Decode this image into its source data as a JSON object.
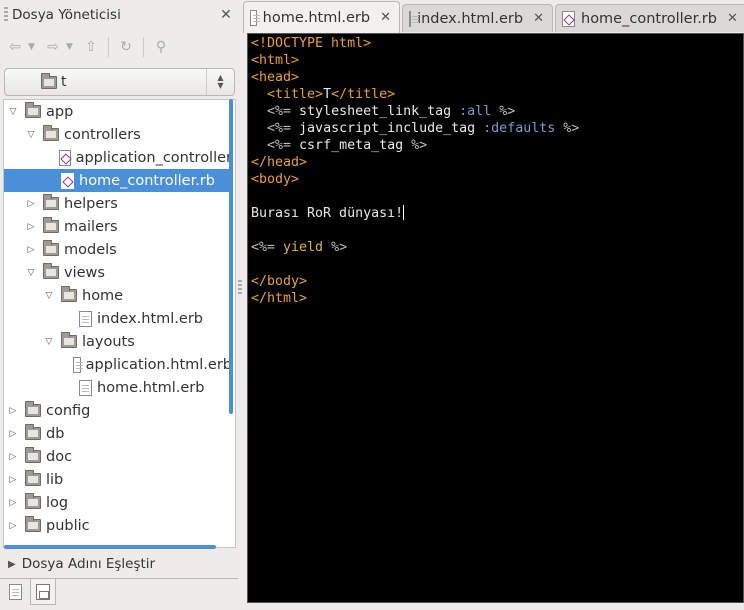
{
  "side_panel": {
    "title": "Dosya Yöneticisi",
    "close": "✕",
    "location": "t",
    "bottom_label": "Dosya Adını Eşleştir"
  },
  "tree": [
    {
      "label": "app",
      "kind": "folder",
      "expanded": true,
      "depth": 0
    },
    {
      "label": "controllers",
      "kind": "folder",
      "expanded": true,
      "depth": 1
    },
    {
      "label": "application_controller",
      "kind": "rb",
      "depth": 2
    },
    {
      "label": "home_controller.rb",
      "kind": "rb",
      "depth": 2,
      "selected": true
    },
    {
      "label": "helpers",
      "kind": "folder",
      "expanded": false,
      "depth": 1
    },
    {
      "label": "mailers",
      "kind": "folder",
      "expanded": false,
      "depth": 1
    },
    {
      "label": "models",
      "kind": "folder",
      "expanded": false,
      "depth": 1
    },
    {
      "label": "views",
      "kind": "folder",
      "expanded": true,
      "depth": 1
    },
    {
      "label": "home",
      "kind": "folder",
      "expanded": true,
      "depth": 2
    },
    {
      "label": "index.html.erb",
      "kind": "file",
      "depth": 3
    },
    {
      "label": "layouts",
      "kind": "folder",
      "expanded": true,
      "depth": 2
    },
    {
      "label": "application.html.erb",
      "kind": "file",
      "depth": 3
    },
    {
      "label": "home.html.erb",
      "kind": "file",
      "depth": 3
    },
    {
      "label": "config",
      "kind": "folder",
      "expanded": false,
      "depth": 0
    },
    {
      "label": "db",
      "kind": "folder",
      "expanded": false,
      "depth": 0
    },
    {
      "label": "doc",
      "kind": "folder",
      "expanded": false,
      "depth": 0
    },
    {
      "label": "lib",
      "kind": "folder",
      "expanded": false,
      "depth": 0
    },
    {
      "label": "log",
      "kind": "folder",
      "expanded": false,
      "depth": 0
    },
    {
      "label": "public",
      "kind": "folder",
      "expanded": false,
      "depth": 0
    }
  ],
  "tabs": [
    {
      "label": "home.html.erb",
      "active": true,
      "close": "✕"
    },
    {
      "label": "index.html.erb",
      "active": false,
      "close": "✕"
    },
    {
      "label": "home_controller.rb",
      "active": false,
      "close": "✕"
    }
  ],
  "editor": {
    "lines": [
      [
        [
          "tag",
          "<!DOCTYPE html>"
        ]
      ],
      [
        [
          "tag",
          "<html>"
        ]
      ],
      [
        [
          "tag",
          "<head>"
        ]
      ],
      [
        [
          "txt",
          "  "
        ],
        [
          "tag",
          "<title>"
        ],
        [
          "txt",
          "T"
        ],
        [
          "tag",
          "</title>"
        ]
      ],
      [
        [
          "txt",
          "  "
        ],
        [
          "erb",
          "<%= "
        ],
        [
          "txt",
          "stylesheet_link_tag "
        ],
        [
          "sym",
          ":all"
        ],
        [
          "erb",
          " %>"
        ]
      ],
      [
        [
          "txt",
          "  "
        ],
        [
          "erb",
          "<%= "
        ],
        [
          "txt",
          "javascript_include_tag "
        ],
        [
          "sym",
          ":defaults"
        ],
        [
          "erb",
          " %>"
        ]
      ],
      [
        [
          "txt",
          "  "
        ],
        [
          "erb",
          "<%= "
        ],
        [
          "txt",
          "csrf_meta_tag"
        ],
        [
          "erb",
          " %>"
        ]
      ],
      [
        [
          "tag",
          "</head>"
        ]
      ],
      [
        [
          "tag",
          "<body>"
        ]
      ],
      [],
      [
        [
          "txt",
          "Burası RoR dünyası!"
        ],
        [
          "caret",
          ""
        ]
      ],
      [],
      [
        [
          "erb",
          "<%= "
        ],
        [
          "kw",
          "yield"
        ],
        [
          "erb",
          " %>"
        ]
      ],
      [],
      [
        [
          "tag",
          "</body>"
        ]
      ],
      [
        [
          "tag",
          "</html>"
        ]
      ]
    ]
  },
  "colors": {
    "selection": "#4a90d9",
    "editor_bg": "#000000",
    "tag": "#e6a03c",
    "symbol": "#729fcf"
  }
}
